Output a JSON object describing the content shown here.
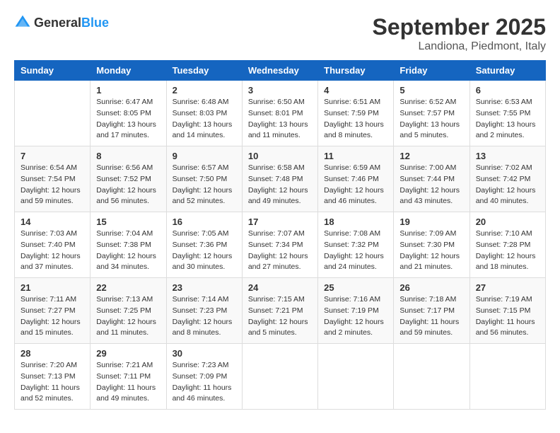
{
  "header": {
    "logo_general": "General",
    "logo_blue": "Blue",
    "month": "September 2025",
    "location": "Landiona, Piedmont, Italy"
  },
  "columns": [
    "Sunday",
    "Monday",
    "Tuesday",
    "Wednesday",
    "Thursday",
    "Friday",
    "Saturday"
  ],
  "weeks": [
    [
      {
        "day": "",
        "sunrise": "",
        "sunset": "",
        "daylight": ""
      },
      {
        "day": "1",
        "sunrise": "Sunrise: 6:47 AM",
        "sunset": "Sunset: 8:05 PM",
        "daylight": "Daylight: 13 hours and 17 minutes."
      },
      {
        "day": "2",
        "sunrise": "Sunrise: 6:48 AM",
        "sunset": "Sunset: 8:03 PM",
        "daylight": "Daylight: 13 hours and 14 minutes."
      },
      {
        "day": "3",
        "sunrise": "Sunrise: 6:50 AM",
        "sunset": "Sunset: 8:01 PM",
        "daylight": "Daylight: 13 hours and 11 minutes."
      },
      {
        "day": "4",
        "sunrise": "Sunrise: 6:51 AM",
        "sunset": "Sunset: 7:59 PM",
        "daylight": "Daylight: 13 hours and 8 minutes."
      },
      {
        "day": "5",
        "sunrise": "Sunrise: 6:52 AM",
        "sunset": "Sunset: 7:57 PM",
        "daylight": "Daylight: 13 hours and 5 minutes."
      },
      {
        "day": "6",
        "sunrise": "Sunrise: 6:53 AM",
        "sunset": "Sunset: 7:55 PM",
        "daylight": "Daylight: 13 hours and 2 minutes."
      }
    ],
    [
      {
        "day": "7",
        "sunrise": "Sunrise: 6:54 AM",
        "sunset": "Sunset: 7:54 PM",
        "daylight": "Daylight: 12 hours and 59 minutes."
      },
      {
        "day": "8",
        "sunrise": "Sunrise: 6:56 AM",
        "sunset": "Sunset: 7:52 PM",
        "daylight": "Daylight: 12 hours and 56 minutes."
      },
      {
        "day": "9",
        "sunrise": "Sunrise: 6:57 AM",
        "sunset": "Sunset: 7:50 PM",
        "daylight": "Daylight: 12 hours and 52 minutes."
      },
      {
        "day": "10",
        "sunrise": "Sunrise: 6:58 AM",
        "sunset": "Sunset: 7:48 PM",
        "daylight": "Daylight: 12 hours and 49 minutes."
      },
      {
        "day": "11",
        "sunrise": "Sunrise: 6:59 AM",
        "sunset": "Sunset: 7:46 PM",
        "daylight": "Daylight: 12 hours and 46 minutes."
      },
      {
        "day": "12",
        "sunrise": "Sunrise: 7:00 AM",
        "sunset": "Sunset: 7:44 PM",
        "daylight": "Daylight: 12 hours and 43 minutes."
      },
      {
        "day": "13",
        "sunrise": "Sunrise: 7:02 AM",
        "sunset": "Sunset: 7:42 PM",
        "daylight": "Daylight: 12 hours and 40 minutes."
      }
    ],
    [
      {
        "day": "14",
        "sunrise": "Sunrise: 7:03 AM",
        "sunset": "Sunset: 7:40 PM",
        "daylight": "Daylight: 12 hours and 37 minutes."
      },
      {
        "day": "15",
        "sunrise": "Sunrise: 7:04 AM",
        "sunset": "Sunset: 7:38 PM",
        "daylight": "Daylight: 12 hours and 34 minutes."
      },
      {
        "day": "16",
        "sunrise": "Sunrise: 7:05 AM",
        "sunset": "Sunset: 7:36 PM",
        "daylight": "Daylight: 12 hours and 30 minutes."
      },
      {
        "day": "17",
        "sunrise": "Sunrise: 7:07 AM",
        "sunset": "Sunset: 7:34 PM",
        "daylight": "Daylight: 12 hours and 27 minutes."
      },
      {
        "day": "18",
        "sunrise": "Sunrise: 7:08 AM",
        "sunset": "Sunset: 7:32 PM",
        "daylight": "Daylight: 12 hours and 24 minutes."
      },
      {
        "day": "19",
        "sunrise": "Sunrise: 7:09 AM",
        "sunset": "Sunset: 7:30 PM",
        "daylight": "Daylight: 12 hours and 21 minutes."
      },
      {
        "day": "20",
        "sunrise": "Sunrise: 7:10 AM",
        "sunset": "Sunset: 7:28 PM",
        "daylight": "Daylight: 12 hours and 18 minutes."
      }
    ],
    [
      {
        "day": "21",
        "sunrise": "Sunrise: 7:11 AM",
        "sunset": "Sunset: 7:27 PM",
        "daylight": "Daylight: 12 hours and 15 minutes."
      },
      {
        "day": "22",
        "sunrise": "Sunrise: 7:13 AM",
        "sunset": "Sunset: 7:25 PM",
        "daylight": "Daylight: 12 hours and 11 minutes."
      },
      {
        "day": "23",
        "sunrise": "Sunrise: 7:14 AM",
        "sunset": "Sunset: 7:23 PM",
        "daylight": "Daylight: 12 hours and 8 minutes."
      },
      {
        "day": "24",
        "sunrise": "Sunrise: 7:15 AM",
        "sunset": "Sunset: 7:21 PM",
        "daylight": "Daylight: 12 hours and 5 minutes."
      },
      {
        "day": "25",
        "sunrise": "Sunrise: 7:16 AM",
        "sunset": "Sunset: 7:19 PM",
        "daylight": "Daylight: 12 hours and 2 minutes."
      },
      {
        "day": "26",
        "sunrise": "Sunrise: 7:18 AM",
        "sunset": "Sunset: 7:17 PM",
        "daylight": "Daylight: 11 hours and 59 minutes."
      },
      {
        "day": "27",
        "sunrise": "Sunrise: 7:19 AM",
        "sunset": "Sunset: 7:15 PM",
        "daylight": "Daylight: 11 hours and 56 minutes."
      }
    ],
    [
      {
        "day": "28",
        "sunrise": "Sunrise: 7:20 AM",
        "sunset": "Sunset: 7:13 PM",
        "daylight": "Daylight: 11 hours and 52 minutes."
      },
      {
        "day": "29",
        "sunrise": "Sunrise: 7:21 AM",
        "sunset": "Sunset: 7:11 PM",
        "daylight": "Daylight: 11 hours and 49 minutes."
      },
      {
        "day": "30",
        "sunrise": "Sunrise: 7:23 AM",
        "sunset": "Sunset: 7:09 PM",
        "daylight": "Daylight: 11 hours and 46 minutes."
      },
      {
        "day": "",
        "sunrise": "",
        "sunset": "",
        "daylight": ""
      },
      {
        "day": "",
        "sunrise": "",
        "sunset": "",
        "daylight": ""
      },
      {
        "day": "",
        "sunrise": "",
        "sunset": "",
        "daylight": ""
      },
      {
        "day": "",
        "sunrise": "",
        "sunset": "",
        "daylight": ""
      }
    ]
  ]
}
